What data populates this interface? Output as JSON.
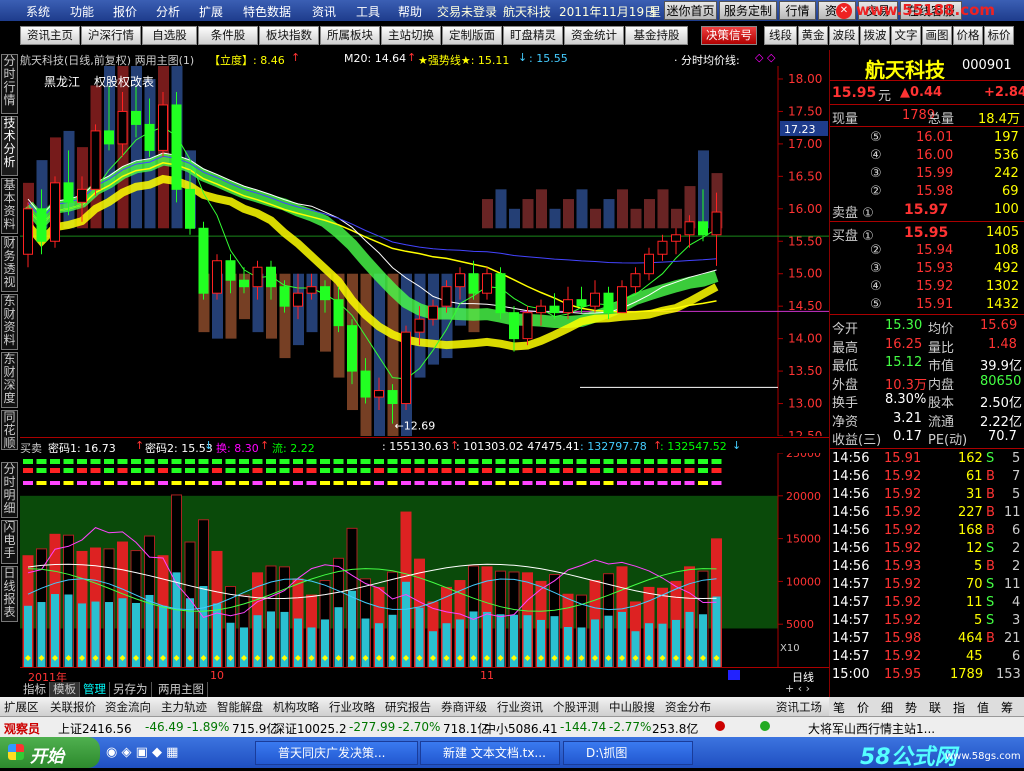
{
  "menu": {
    "items": [
      "系统",
      "功能",
      "报价",
      "分析",
      "扩展",
      "特色数据",
      "资讯",
      "工具",
      "帮助"
    ],
    "status_text": "交易未登录",
    "stock_name": "航天科技",
    "date": "2011年11月19日",
    "weekday": "星",
    "right_buttons": [
      "迷你首页",
      "服务定制",
      "行情",
      "资讯",
      "交易",
      "在线客服"
    ],
    "watermark": "www.55188.com"
  },
  "toolbar": {
    "buttons": [
      "资讯主页",
      "沪深行情",
      "自选股",
      "条件股",
      "板块指数",
      "所属板块",
      "主站切换",
      "定制版面",
      "盯盘精灵",
      "资金统计",
      "基金持股",
      "决策信号",
      "线段",
      "黄金",
      "波段",
      "拨波",
      "文字",
      "画图",
      "价格",
      "标价"
    ]
  },
  "left_tabs": [
    "分时行情",
    "技术分析",
    "基本资料",
    "财务透视",
    "东财资料",
    "东财深度",
    "同花顺",
    "分时明细",
    "闪电手",
    "日线报表"
  ],
  "main_chart": {
    "title": "航天科技(日线,前复权) 两用主图(1)",
    "indicator1": "【立度】: 8.46",
    "indicator1_arrow": "↑",
    "ma_label": "M20: 14.64",
    "ma_arrow": "↑",
    "strong_label": "★强势线★: 15.11",
    "strong_arrow": "↓",
    "strong_value2": ": 15.55",
    "avg_label": "· 分时均价线:",
    "annotation_left": "黑龙江",
    "annotation_right": "权股权改表",
    "low_label": "←12.69",
    "price_marker": "17.23"
  },
  "chart_data": [
    {
      "type": "candlestick",
      "title": "航天科技(日线,前复权) 两用主图(1)",
      "ylim": [
        12.5,
        18.2
      ],
      "y_ticks": [
        "18.00",
        "17.50",
        "17.00",
        "16.50",
        "16.00",
        "15.50",
        "15.00",
        "14.50",
        "14.00",
        "13.50",
        "13.00",
        "12.50"
      ],
      "x_labels": [
        "10",
        "11"
      ],
      "candles": [
        {
          "o": 15.3,
          "h": 16.1,
          "l": 15.1,
          "c": 16.0
        },
        {
          "o": 16.0,
          "h": 16.3,
          "l": 15.3,
          "c": 15.5
        },
        {
          "o": 15.5,
          "h": 16.5,
          "l": 15.4,
          "c": 16.4
        },
        {
          "o": 16.4,
          "h": 16.9,
          "l": 15.9,
          "c": 16.1
        },
        {
          "o": 16.1,
          "h": 16.5,
          "l": 15.8,
          "c": 16.3
        },
        {
          "o": 16.3,
          "h": 17.3,
          "l": 16.2,
          "c": 17.2
        },
        {
          "o": 17.2,
          "h": 17.9,
          "l": 16.9,
          "c": 17.0
        },
        {
          "o": 17.0,
          "h": 17.8,
          "l": 16.8,
          "c": 17.5
        },
        {
          "o": 17.5,
          "h": 17.9,
          "l": 17.1,
          "c": 17.3
        },
        {
          "o": 17.3,
          "h": 17.7,
          "l": 16.8,
          "c": 16.9
        },
        {
          "o": 16.9,
          "h": 17.8,
          "l": 16.8,
          "c": 17.6
        },
        {
          "o": 17.6,
          "h": 17.8,
          "l": 16.1,
          "c": 16.3
        },
        {
          "o": 16.3,
          "h": 16.6,
          "l": 15.6,
          "c": 15.7
        },
        {
          "o": 15.7,
          "h": 15.8,
          "l": 14.6,
          "c": 14.7
        },
        {
          "o": 14.7,
          "h": 15.3,
          "l": 14.6,
          "c": 15.2
        },
        {
          "o": 15.2,
          "h": 15.3,
          "l": 14.7,
          "c": 14.9
        },
        {
          "o": 14.9,
          "h": 15.1,
          "l": 14.7,
          "c": 14.8
        },
        {
          "o": 14.8,
          "h": 15.2,
          "l": 14.6,
          "c": 15.1
        },
        {
          "o": 15.1,
          "h": 15.2,
          "l": 14.6,
          "c": 14.8
        },
        {
          "o": 14.8,
          "h": 14.9,
          "l": 14.4,
          "c": 14.5
        },
        {
          "o": 14.5,
          "h": 15.0,
          "l": 14.3,
          "c": 14.7
        },
        {
          "o": 14.7,
          "h": 15.0,
          "l": 14.6,
          "c": 14.8
        },
        {
          "o": 14.8,
          "h": 14.9,
          "l": 14.4,
          "c": 14.6
        },
        {
          "o": 14.6,
          "h": 14.8,
          "l": 14.1,
          "c": 14.2
        },
        {
          "o": 14.2,
          "h": 14.3,
          "l": 13.3,
          "c": 13.5
        },
        {
          "o": 13.5,
          "h": 13.7,
          "l": 13.0,
          "c": 13.1
        },
        {
          "o": 13.1,
          "h": 13.4,
          "l": 12.9,
          "c": 13.2
        },
        {
          "o": 13.2,
          "h": 13.3,
          "l": 12.69,
          "c": 13.0
        },
        {
          "o": 13.0,
          "h": 14.2,
          "l": 12.9,
          "c": 14.1
        },
        {
          "o": 14.1,
          "h": 14.5,
          "l": 13.9,
          "c": 14.3
        },
        {
          "o": 14.3,
          "h": 14.6,
          "l": 14.2,
          "c": 14.5
        },
        {
          "o": 14.5,
          "h": 14.9,
          "l": 14.4,
          "c": 14.8
        },
        {
          "o": 14.8,
          "h": 15.1,
          "l": 14.6,
          "c": 15.0
        },
        {
          "o": 15.0,
          "h": 15.2,
          "l": 14.6,
          "c": 14.7
        },
        {
          "o": 14.7,
          "h": 15.1,
          "l": 14.6,
          "c": 15.0
        },
        {
          "o": 15.0,
          "h": 15.1,
          "l": 14.3,
          "c": 14.4
        },
        {
          "o": 14.4,
          "h": 14.5,
          "l": 13.8,
          "c": 14.0
        },
        {
          "o": 14.0,
          "h": 14.5,
          "l": 13.9,
          "c": 14.4
        },
        {
          "o": 14.4,
          "h": 14.6,
          "l": 14.2,
          "c": 14.5
        },
        {
          "o": 14.5,
          "h": 14.7,
          "l": 14.3,
          "c": 14.4
        },
        {
          "o": 14.4,
          "h": 14.8,
          "l": 14.3,
          "c": 14.6
        },
        {
          "o": 14.6,
          "h": 14.8,
          "l": 14.4,
          "c": 14.5
        },
        {
          "o": 14.5,
          "h": 14.9,
          "l": 14.4,
          "c": 14.7
        },
        {
          "o": 14.7,
          "h": 14.8,
          "l": 14.3,
          "c": 14.4
        },
        {
          "o": 14.4,
          "h": 14.9,
          "l": 14.4,
          "c": 14.8
        },
        {
          "o": 14.8,
          "h": 15.1,
          "l": 14.7,
          "c": 15.0
        },
        {
          "o": 15.0,
          "h": 15.4,
          "l": 14.9,
          "c": 15.3
        },
        {
          "o": 15.3,
          "h": 15.6,
          "l": 15.2,
          "c": 15.5
        },
        {
          "o": 15.5,
          "h": 15.7,
          "l": 15.3,
          "c": 15.6
        },
        {
          "o": 15.6,
          "h": 15.9,
          "l": 15.4,
          "c": 15.8
        },
        {
          "o": 15.8,
          "h": 16.3,
          "l": 15.5,
          "c": 15.6
        },
        {
          "o": 15.6,
          "h": 16.25,
          "l": 15.12,
          "c": 15.95
        }
      ]
    },
    {
      "type": "bar",
      "title": "买卖",
      "ylim": [
        0,
        25000
      ],
      "y_ticks": [
        "25000",
        "20000",
        "15000",
        "10000",
        "5000"
      ],
      "multiplier_label": "X10"
    }
  ],
  "sub_chart": {
    "label": "买卖",
    "code1": "密码1: 16.73",
    "code1_arrow": "↑",
    "code2": "密码2: 15.53",
    "code2_arrow": "↓",
    "huan": "换: 8.30",
    "huan_arrow": "↑",
    "liu": "流: 2.22",
    "v1": ": 155130.63",
    "v1_arrow": "↑",
    "v2": ": 101303.02",
    "v3": ": 47475.41",
    "v4": ": 132797.78",
    "v4_arrow": "↑",
    "v5": ": 132547.52",
    "v5_arrow": "↓",
    "time_left": "2011年",
    "time_mid1": "10",
    "time_mid2": "11",
    "period": "日线"
  },
  "quote": {
    "name": "航天科技",
    "code": "000901",
    "price": "15.95",
    "unit": "元",
    "change": "▲0.44",
    "change_pct": "+2.84",
    "now_vol_label": "现量",
    "now_vol": "1789",
    "total_vol_label": "总量",
    "total_vol": "18.4万",
    "asks": [
      {
        "lv": "⑤",
        "p": "16.01",
        "v": "197"
      },
      {
        "lv": "④",
        "p": "16.00",
        "v": "536"
      },
      {
        "lv": "③",
        "p": "15.99",
        "v": "242"
      },
      {
        "lv": "②",
        "p": "15.98",
        "v": "69"
      }
    ],
    "ask1_label": "卖盘 ①",
    "ask1_p": "15.97",
    "ask1_v": "100",
    "bid1_label": "买盘 ①",
    "bid1_p": "15.95",
    "bid1_v": "1405",
    "bids": [
      {
        "lv": "②",
        "p": "15.94",
        "v": "108"
      },
      {
        "lv": "③",
        "p": "15.93",
        "v": "492"
      },
      {
        "lv": "④",
        "p": "15.92",
        "v": "1302"
      },
      {
        "lv": "⑤",
        "p": "15.91",
        "v": "1432"
      }
    ],
    "stats": [
      {
        "l1": "今开",
        "v1": "15.30",
        "l2": "均价",
        "v2": "15.69"
      },
      {
        "l1": "最高",
        "v1": "16.25",
        "l2": "量比",
        "v2": "1.48"
      },
      {
        "l1": "最低",
        "v1": "15.12",
        "l2": "市值",
        "v2": "39.9亿"
      },
      {
        "l1": "外盘",
        "v1": "10.3万",
        "l2": "内盘",
        "v2": "80650"
      },
      {
        "l1": "换手",
        "v1": "8.30%",
        "l2": "股本",
        "v2": "2.50亿"
      },
      {
        "l1": "净资",
        "v1": "3.21",
        "l2": "流通",
        "v2": "2.22亿"
      },
      {
        "l1": "收益(三)",
        "v1": "0.17",
        "l2": "PE(动)",
        "v2": "70.7"
      }
    ],
    "ticks": [
      {
        "t": "14:56",
        "p": "15.91",
        "v": "162",
        "s": "S",
        "n": "5"
      },
      {
        "t": "14:56",
        "p": "15.92",
        "v": "61",
        "s": "B",
        "n": "7"
      },
      {
        "t": "14:56",
        "p": "15.92",
        "v": "31",
        "s": "B",
        "n": "5"
      },
      {
        "t": "14:56",
        "p": "15.92",
        "v": "227",
        "s": "B",
        "n": "11"
      },
      {
        "t": "14:56",
        "p": "15.92",
        "v": "168",
        "s": "B",
        "n": "6"
      },
      {
        "t": "14:56",
        "p": "15.92",
        "v": "12",
        "s": "S",
        "n": "2"
      },
      {
        "t": "14:56",
        "p": "15.93",
        "v": "5",
        "s": "B",
        "n": "2"
      },
      {
        "t": "14:57",
        "p": "15.92",
        "v": "70",
        "s": "S",
        "n": "11"
      },
      {
        "t": "14:57",
        "p": "15.92",
        "v": "11",
        "s": "S",
        "n": "4"
      },
      {
        "t": "14:57",
        "p": "15.92",
        "v": "5",
        "s": "S",
        "n": "3"
      },
      {
        "t": "14:57",
        "p": "15.98",
        "v": "464",
        "s": "B",
        "n": "21"
      },
      {
        "t": "14:57",
        "p": "15.92",
        "v": "45",
        "s": "",
        "n": "6"
      },
      {
        "t": "15:00",
        "p": "15.95",
        "v": "1789",
        "s": "",
        "n": "153"
      }
    ],
    "bottom_tabs": [
      "笔",
      "价",
      "细",
      "势",
      "联",
      "指",
      "值",
      "筹"
    ]
  },
  "bottom_tabs": [
    "指标",
    "模板",
    "管理",
    "另存为",
    "两用主图"
  ],
  "func_tabs": [
    "扩展区",
    "关联报价",
    "资金流向",
    "主力轨迹",
    "智能解盘",
    "机构攻略",
    "行业攻略",
    "研究报告",
    "券商评级",
    "行业资讯",
    "个股评测",
    "中山股搜",
    "资金分布",
    "资讯工场"
  ],
  "statusbar": {
    "label": "观察员",
    "sh": "上证2416.56",
    "sh_chg": "-46.49",
    "sh_pct": "-1.89%",
    "sh_amt": "715.9亿",
    "sz": "深证10025.2",
    "sz_chg": "-277.99",
    "sz_pct": "-2.70%",
    "sz_amt": "718.1亿",
    "zx": "中小5086.41",
    "zx_chg": "-144.74",
    "zx_pct": "-2.77%",
    "zx_amt": "253.8亿",
    "server": "大将军山西行情主站1..."
  },
  "taskbar": {
    "start": "开始",
    "tasks": [
      "普天同庆广发决策...",
      "新建 文本文档.tx...",
      "D:\\抓图"
    ],
    "logo": "58公式网",
    "logo_url": "www.58gs.com"
  }
}
